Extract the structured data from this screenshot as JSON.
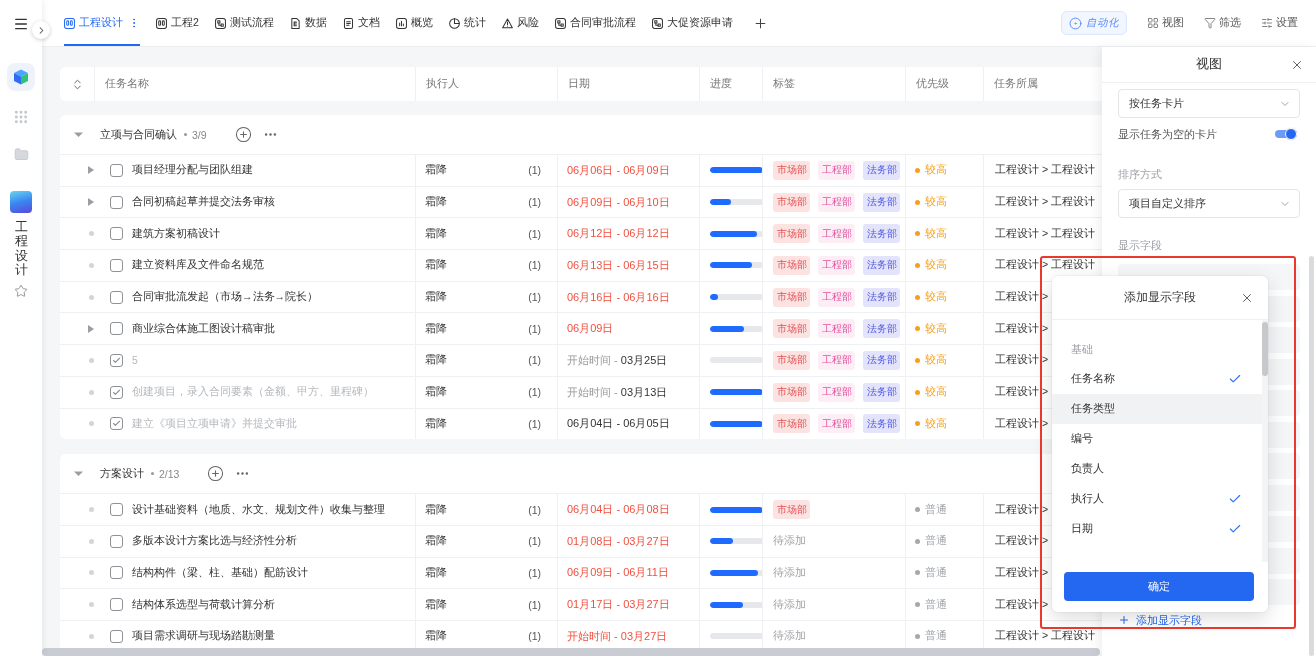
{
  "sidebar": {
    "app_label": "工程设计"
  },
  "tabs": [
    {
      "label": "工程设计",
      "kind": "board",
      "selected": true
    },
    {
      "label": "工程2",
      "kind": "board",
      "selected": false
    },
    {
      "label": "测试流程",
      "kind": "flow",
      "selected": false
    },
    {
      "label": "数据",
      "kind": "data",
      "selected": false
    },
    {
      "label": "文档",
      "kind": "doc",
      "selected": false
    },
    {
      "label": "概览",
      "kind": "overview",
      "selected": false
    },
    {
      "label": "统计",
      "kind": "stats",
      "selected": false
    },
    {
      "label": "风险",
      "kind": "risk",
      "selected": false
    },
    {
      "label": "合同审批流程",
      "kind": "flow",
      "selected": false
    },
    {
      "label": "大促资源申请",
      "kind": "flow",
      "selected": false
    }
  ],
  "toolbar": [
    {
      "label": "自动化",
      "kind": "automation"
    },
    {
      "label": "视图",
      "kind": "view"
    },
    {
      "label": "筛选",
      "kind": "filter"
    },
    {
      "label": "设置",
      "kind": "settings"
    }
  ],
  "table": {
    "columns": [
      "任务名称",
      "执行人",
      "日期",
      "进度",
      "标签",
      "优先级",
      "任务所属"
    ],
    "groups": [
      {
        "title": "立项与合同确认",
        "count": "3/9",
        "expanded": true,
        "rows": [
          {
            "name": "项目经理分配与团队组建",
            "expandable": true,
            "done": false,
            "assignee": "霜降",
            "assignee_count": "(1)",
            "date": "06月06日 - 06月09日",
            "overdue": true,
            "level": 1,
            "tags": [
              {
                "label": "市场部",
                "color": "#fde2e2"
              },
              {
                "label": "工程部",
                "color": "#fdeef6"
              },
              {
                "label": "法务部",
                "color": "#e3e4fb"
              }
            ],
            "priority": {
              "label": "较高",
              "color": "#f5a11c"
            },
            "project": "工程设计 > 工程设计"
          },
          {
            "name": "合同初稿起草并提交法务审核",
            "expandable": true,
            "done": false,
            "assignee": "霜降",
            "assignee_count": "(1)",
            "date": "06月09日 - 06月10日",
            "overdue": true,
            "level": 0.4,
            "tags": [
              {
                "label": "市场部",
                "color": "#fde2e2"
              },
              {
                "label": "工程部",
                "color": "#fdeef6"
              },
              {
                "label": "法务部",
                "color": "#e3e4fb"
              }
            ],
            "priority": {
              "label": "较高",
              "color": "#f5a11c"
            },
            "project": "工程设计 > 工程设计"
          },
          {
            "name": "建筑方案初稿设计",
            "expandable": false,
            "done": false,
            "assignee": "霜降",
            "assignee_count": "(1)",
            "date": "06月12日 - 06月12日",
            "overdue": true,
            "level": 0.88,
            "tags": [
              {
                "label": "市场部",
                "color": "#fde2e2"
              },
              {
                "label": "工程部",
                "color": "#fdeef6"
              },
              {
                "label": "法务部",
                "color": "#e3e4fb"
              }
            ],
            "priority": {
              "label": "较高",
              "color": "#f5a11c"
            },
            "project": "工程设计 > 工程设计"
          },
          {
            "name": "建立资料库及文件命名规范",
            "expandable": false,
            "done": false,
            "assignee": "霜降",
            "assignee_count": "(1)",
            "date": "06月13日 - 06月15日",
            "overdue": true,
            "level": 0.8,
            "tags": [
              {
                "label": "市场部",
                "color": "#fde2e2"
              },
              {
                "label": "工程部",
                "color": "#fdeef6"
              },
              {
                "label": "法务部",
                "color": "#e3e4fb"
              }
            ],
            "priority": {
              "label": "较高",
              "color": "#f5a11c"
            },
            "project": "工程设计 > 工程设计"
          },
          {
            "name": "合同审批流发起（市场→法务→院长）",
            "expandable": false,
            "done": false,
            "assignee": "霜降",
            "assignee_count": "(1)",
            "date": "06月16日 - 06月16日",
            "overdue": true,
            "level": 0.15,
            "tags": [
              {
                "label": "市场部",
                "color": "#fde2e2"
              },
              {
                "label": "工程部",
                "color": "#fdeef6"
              },
              {
                "label": "法务部",
                "color": "#e3e4fb"
              }
            ],
            "priority": {
              "label": "较高",
              "color": "#f5a11c"
            },
            "project": "工程设计 >"
          },
          {
            "name": "商业综合体施工图设计稿审批",
            "expandable": true,
            "done": false,
            "assignee": "霜降",
            "assignee_count": "(1)",
            "date": "06月09日",
            "overdue": true,
            "level": 0.65,
            "tags": [
              {
                "label": "市场部",
                "color": "#fde2e2"
              },
              {
                "label": "工程部",
                "color": "#fdeef6"
              },
              {
                "label": "法务部",
                "color": "#e3e4fb"
              }
            ],
            "priority": {
              "label": "较高",
              "color": "#f5a11c"
            },
            "project": "工程设计 >"
          },
          {
            "name": "5",
            "expandable": false,
            "done": true,
            "assignee": "霜降",
            "assignee_count": "(1)",
            "date_prefix": "开始时间 -",
            "date": "03月25日",
            "overdue": false,
            "level": 0,
            "tags": [
              {
                "label": "市场部",
                "color": "#fde2e2"
              },
              {
                "label": "工程部",
                "color": "#fdeef6"
              },
              {
                "label": "法务部",
                "color": "#e3e4fb"
              }
            ],
            "priority": {
              "label": "较高",
              "color": "#f5a11c"
            },
            "project": "工程设计 >"
          },
          {
            "name": "创建项目，录入合同要素（金额、甲方、里程碑）",
            "expandable": false,
            "done": true,
            "assignee": "霜降",
            "assignee_count": "(1)",
            "date_prefix": "开始时间 -",
            "date": "03月13日",
            "overdue": false,
            "level": 1,
            "tags": [
              {
                "label": "市场部",
                "color": "#fde2e2"
              },
              {
                "label": "工程部",
                "color": "#fdeef6"
              },
              {
                "label": "法务部",
                "color": "#e3e4fb"
              }
            ],
            "priority": {
              "label": "较高",
              "color": "#f5a11c"
            },
            "project": "工程设计 >"
          },
          {
            "name": "建立《项目立项申请》并提交审批",
            "expandable": false,
            "done": true,
            "assignee": "霜降",
            "assignee_count": "(1)",
            "date": "06月04日 - 06月05日",
            "overdue": false,
            "level": 1,
            "tags": [
              {
                "label": "市场部",
                "color": "#fde2e2"
              },
              {
                "label": "工程部",
                "color": "#fdeef6"
              },
              {
                "label": "法务部",
                "color": "#e3e4fb"
              }
            ],
            "priority": {
              "label": "较高",
              "color": "#f5a11c"
            },
            "project": "工程设计 >"
          }
        ]
      },
      {
        "title": "方案设计",
        "count": "2/13",
        "expanded": true,
        "rows": [
          {
            "name": "设计基础资料（地质、水文、规划文件）收集与整理",
            "expandable": false,
            "done": false,
            "assignee": "霜降",
            "assignee_count": "(1)",
            "date": "06月04日 - 06月08日",
            "overdue": true,
            "level": 1,
            "tags": [
              {
                "label": "市场部",
                "color": "#fde2e2"
              }
            ],
            "priority": {
              "label": "普通",
              "color": "#a5a8ad"
            },
            "project": "工程设计 >"
          },
          {
            "name": "多版本设计方案比选与经济性分析",
            "expandable": false,
            "done": false,
            "assignee": "霜降",
            "assignee_count": "(1)",
            "date": "01月08日 - 03月27日",
            "overdue": true,
            "level": 0.44,
            "tag_field": {
              "placeholder": "待添加"
            },
            "priority": {
              "label": "普通",
              "color": "#a5a8ad"
            },
            "project": "工程设计 >"
          },
          {
            "name": "结构构件（梁、柱、基础）配筋设计",
            "expandable": false,
            "done": false,
            "assignee": "霜降",
            "assignee_count": "(1)",
            "date": "06月09日 - 06月11日",
            "overdue": true,
            "level": 0.9,
            "tag_field": {
              "placeholder": "待添加"
            },
            "priority": {
              "label": "普通",
              "color": "#a5a8ad"
            },
            "project": "工程设计 >"
          },
          {
            "name": "结构体系选型与荷载计算分析",
            "expandable": false,
            "done": false,
            "assignee": "霜降",
            "assignee_count": "(1)",
            "date": "01月17日 - 03月27日",
            "overdue": true,
            "level": 0.62,
            "tag_field": {
              "placeholder": "待添加"
            },
            "priority": {
              "label": "普通",
              "color": "#a5a8ad"
            },
            "project": "工程设计 >"
          },
          {
            "name": "项目需求调研与现场踏勘测量",
            "expandable": false,
            "done": false,
            "assignee": "霜降",
            "assignee_count": "(1)",
            "date_prefix": "开始时间 -",
            "date": "03月27日",
            "overdue": true,
            "level": 0,
            "tag_field": {
              "placeholder": "待添加"
            },
            "priority": {
              "label": "普通",
              "color": "#a5a8ad"
            },
            "project": "工程设计 > 工程设计"
          }
        ]
      }
    ]
  },
  "view_panel": {
    "title": "视图",
    "group_by": "按任务卡片",
    "show_empty": {
      "label": "显示任务为空的卡片",
      "on": true
    },
    "sort_label": "排序方式",
    "sort": "项目自定义排序",
    "fields_label": "显示字段",
    "add_field": "添加显示字段"
  },
  "add_field_dialog": {
    "title": "添加显示字段",
    "highlighted": true,
    "section": "基础",
    "options": [
      {
        "label": "任务名称",
        "checked": true,
        "highlighted": false
      },
      {
        "label": "任务类型",
        "checked": false,
        "highlighted": true
      },
      {
        "label": "编号",
        "checked": false,
        "highlighted": false
      },
      {
        "label": "负责人",
        "checked": false,
        "highlighted": false
      },
      {
        "label": "执行人",
        "checked": true,
        "highlighted": false
      },
      {
        "label": "日期",
        "checked": true,
        "highlighted": false
      }
    ],
    "confirm": "确定"
  }
}
